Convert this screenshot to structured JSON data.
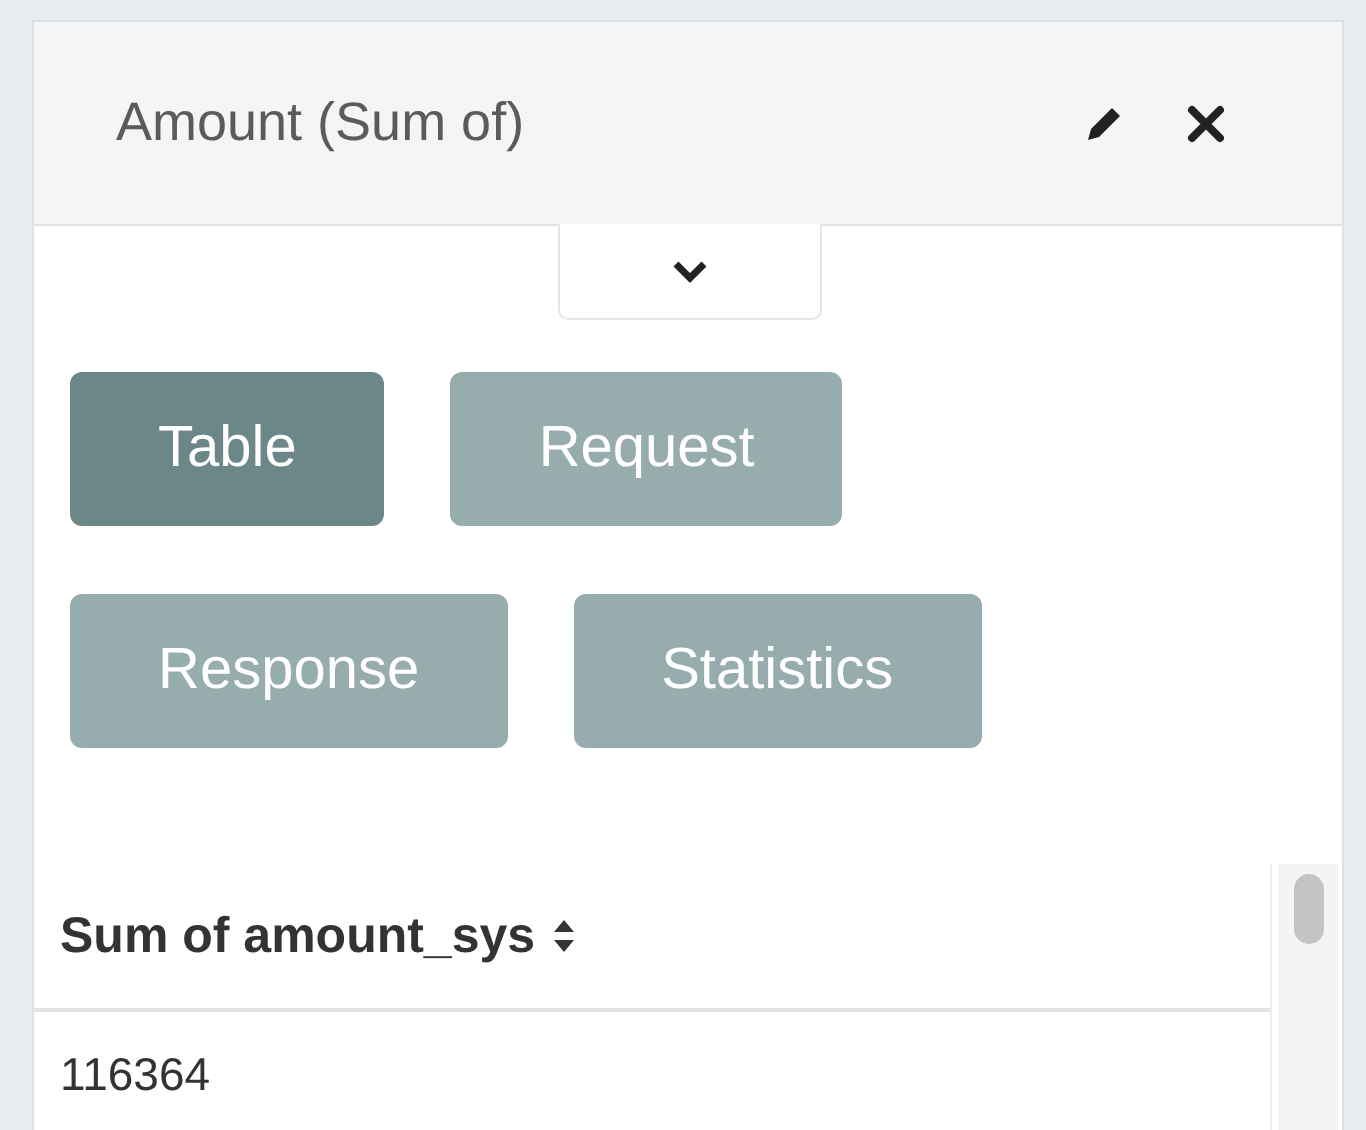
{
  "panel": {
    "title": "Amount (Sum of)"
  },
  "details_toggle": {
    "expanded": false
  },
  "view_buttons": [
    {
      "label": "Table",
      "selected": true
    },
    {
      "label": "Request",
      "selected": false
    },
    {
      "label": "Response",
      "selected": false
    },
    {
      "label": "Statistics",
      "selected": false
    }
  ],
  "table": {
    "columns": [
      "Sum of amount_sys"
    ],
    "rows": [
      [
        "116364"
      ]
    ]
  }
}
